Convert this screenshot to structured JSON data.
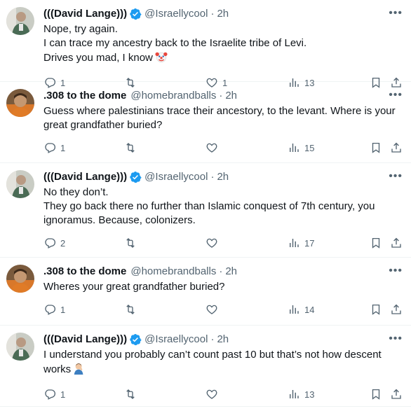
{
  "tweets": [
    {
      "name": "(((David Lange)))",
      "verified": true,
      "handle": "@Israellycool",
      "time": "2h",
      "lines": [
        "Nope, try again.",
        "I can trace my ancestry back to the Israelite tribe of Levi.",
        "Drives you mad, I know"
      ],
      "emoji": "clown-face",
      "replies": "1",
      "retweets": "",
      "likes": "1",
      "views": "13"
    },
    {
      "name": ".308 to the dome",
      "verified": false,
      "handle": "@homebrandballs",
      "time": "2h",
      "lines": [
        "Guess where palestinians trace their ancestory, to the levant. Where is your great grandfather buried?"
      ],
      "emoji": "",
      "replies": "1",
      "retweets": "",
      "likes": "",
      "views": "15"
    },
    {
      "name": "(((David Lange)))",
      "verified": true,
      "handle": "@Israellycool",
      "time": "2h",
      "lines": [
        "No they don’t.",
        "They go back there no further than Islamic conquest of 7th century, you ignoramus. Because, colonizers."
      ],
      "emoji": "",
      "replies": "2",
      "retweets": "",
      "likes": "",
      "views": "17"
    },
    {
      "name": ".308 to the dome",
      "verified": false,
      "handle": "@homebrandballs",
      "time": "2h",
      "lines": [
        "Wheres your great grandfather buried?"
      ],
      "emoji": "",
      "replies": "1",
      "retweets": "",
      "likes": "",
      "views": "14"
    },
    {
      "name": "(((David Lange)))",
      "verified": true,
      "handle": "@Israellycool",
      "time": "2h",
      "lines": [
        "I understand you probably can’t count past 10 but that’s not how descent works"
      ],
      "emoji": "person-facepalming",
      "replies": "1",
      "retweets": "",
      "likes": "",
      "views": "13"
    }
  ],
  "separator": "·",
  "colors": {
    "verified": "#1d9bf0",
    "muted": "#536471",
    "text": "#0f1419"
  }
}
